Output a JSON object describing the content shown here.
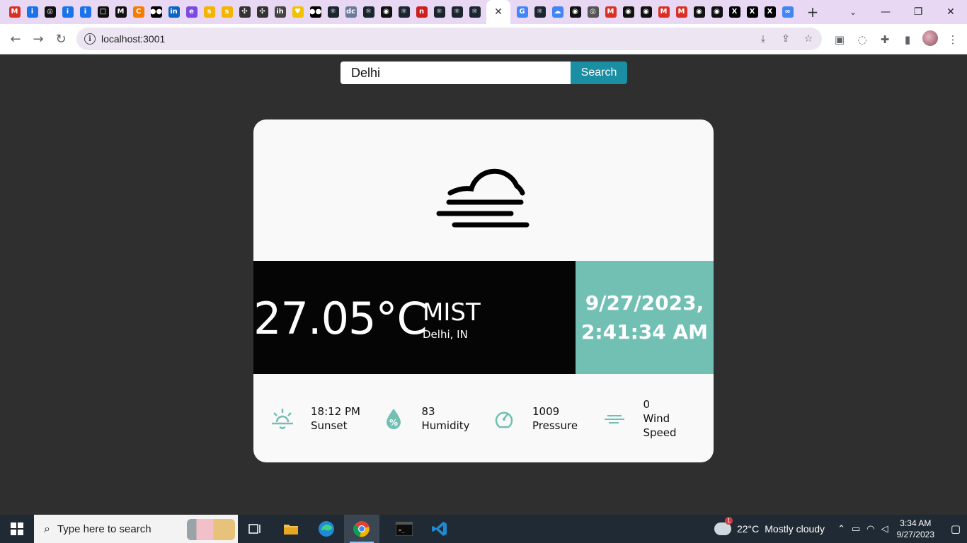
{
  "browser": {
    "tabs": [
      {
        "icon": "gmail-icon",
        "glyph": "M",
        "color": "#d93025"
      },
      {
        "icon": "info-icon",
        "glyph": "i",
        "color": "#1a73e8"
      },
      {
        "icon": "target-icon",
        "glyph": "◎",
        "color": "#111111"
      },
      {
        "icon": "info-box-icon",
        "glyph": "i",
        "color": "#1a73e8"
      },
      {
        "icon": "info-icon",
        "glyph": "i",
        "color": "#1a73e8"
      },
      {
        "icon": "square-icon",
        "glyph": "□",
        "color": "#111111"
      },
      {
        "icon": "medium-m-icon",
        "glyph": "M",
        "color": "#111111"
      },
      {
        "icon": "cc-icon",
        "glyph": "C",
        "color": "#f57c00"
      },
      {
        "icon": "medium-dots-icon",
        "glyph": "●●",
        "color": "#000000"
      },
      {
        "icon": "linkedin-icon",
        "glyph": "in",
        "color": "#0a66c2"
      },
      {
        "icon": "edge-icon",
        "glyph": "e",
        "color": "#7b4ae2"
      },
      {
        "icon": "shine-icon",
        "glyph": "s",
        "color": "#f4b400"
      },
      {
        "icon": "shine-icon",
        "glyph": "s",
        "color": "#f4b400"
      },
      {
        "icon": "wheel-icon",
        "glyph": "✣",
        "color": "#333333"
      },
      {
        "icon": "wheel-icon",
        "glyph": "✣",
        "color": "#333333"
      },
      {
        "icon": "ih-icon",
        "glyph": "ih",
        "color": "#444444"
      },
      {
        "icon": "heart-icon",
        "glyph": "♥",
        "color": "#f2c200"
      },
      {
        "icon": "medium-dots-icon",
        "glyph": "●●",
        "color": "#000000"
      },
      {
        "icon": "react-icon",
        "glyph": "⚛",
        "color": "#1b2530"
      },
      {
        "icon": "dc-icon",
        "glyph": "dc",
        "color": "#6b7a9a"
      },
      {
        "icon": "react-icon",
        "glyph": "⚛",
        "color": "#1b2530"
      },
      {
        "icon": "github-icon",
        "glyph": "◉",
        "color": "#111111"
      },
      {
        "icon": "react-icon",
        "glyph": "⚛",
        "color": "#1b2530"
      },
      {
        "icon": "n-icon",
        "glyph": "n",
        "color": "#cc1f1f"
      },
      {
        "icon": "react-icon",
        "glyph": "⚛",
        "color": "#1b2530"
      },
      {
        "icon": "react-icon",
        "glyph": "⚛",
        "color": "#1b2530"
      },
      {
        "icon": "react-icon",
        "glyph": "⚛",
        "color": "#1b2530"
      }
    ],
    "active_tab_close": "✕",
    "tabs_after": [
      {
        "icon": "google-icon",
        "glyph": "G",
        "color": "#4285f4"
      },
      {
        "icon": "react-icon",
        "glyph": "⚛",
        "color": "#1b2530"
      },
      {
        "icon": "drive-cloud-icon",
        "glyph": "☁",
        "color": "#4285f4"
      },
      {
        "icon": "github-icon",
        "glyph": "◉",
        "color": "#111111"
      },
      {
        "icon": "chrome-icon",
        "glyph": "◎",
        "color": "#555555"
      },
      {
        "icon": "gmail-icon",
        "glyph": "M",
        "color": "#d93025"
      },
      {
        "icon": "github-icon",
        "glyph": "◉",
        "color": "#111111"
      },
      {
        "icon": "github-icon",
        "glyph": "◉",
        "color": "#111111"
      },
      {
        "icon": "gmail-icon",
        "glyph": "M",
        "color": "#d93025"
      },
      {
        "icon": "gmail-icon",
        "glyph": "M",
        "color": "#d93025"
      },
      {
        "icon": "github-icon",
        "glyph": "◉",
        "color": "#111111"
      },
      {
        "icon": "github-icon",
        "glyph": "◉",
        "color": "#111111"
      },
      {
        "icon": "x-icon",
        "glyph": "X",
        "color": "#000000"
      },
      {
        "icon": "x-icon",
        "glyph": "X",
        "color": "#000000"
      },
      {
        "icon": "x-icon",
        "glyph": "X",
        "color": "#000000"
      },
      {
        "icon": "link-icon",
        "glyph": "∞",
        "color": "#4285f4"
      }
    ],
    "new_tab": "+",
    "url": "localhost:3001"
  },
  "app": {
    "search": {
      "value": "Delhi",
      "button_label": "Search"
    },
    "weather": {
      "icon": "mist-icon",
      "temperature": "27.05°C",
      "condition": "MIST",
      "location": "Delhi, IN",
      "date": "9/27/2023,",
      "time": "2:41:34 AM",
      "accent_color": "#72bfb4"
    },
    "stats": [
      {
        "icon": "sunset-icon",
        "value": "18:12 PM",
        "label": "Sunset"
      },
      {
        "icon": "humidity-drop-icon",
        "value": "83",
        "label": "Humidity"
      },
      {
        "icon": "pressure-gauge-icon",
        "value": "1009",
        "label": "Pressure"
      },
      {
        "icon": "wind-icon",
        "value": "0",
        "label": "Wind",
        "label2": "Speed"
      }
    ]
  },
  "taskbar": {
    "search_placeholder": "Type here to search",
    "weather_temp": "22°C",
    "weather_desc": "Mostly cloudy",
    "weather_badge": "1",
    "time": "3:34 AM",
    "date": "9/27/2023"
  }
}
